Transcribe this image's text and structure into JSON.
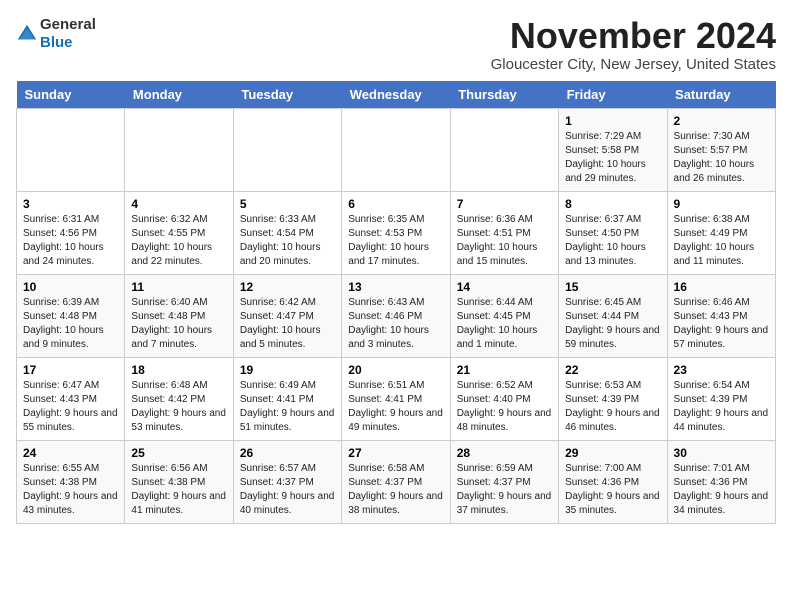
{
  "logo": {
    "general": "General",
    "blue": "Blue"
  },
  "header": {
    "month": "November 2024",
    "location": "Gloucester City, New Jersey, United States"
  },
  "days_of_week": [
    "Sunday",
    "Monday",
    "Tuesday",
    "Wednesday",
    "Thursday",
    "Friday",
    "Saturday"
  ],
  "weeks": [
    [
      {
        "day": "",
        "info": ""
      },
      {
        "day": "",
        "info": ""
      },
      {
        "day": "",
        "info": ""
      },
      {
        "day": "",
        "info": ""
      },
      {
        "day": "",
        "info": ""
      },
      {
        "day": "1",
        "info": "Sunrise: 7:29 AM\nSunset: 5:58 PM\nDaylight: 10 hours and 29 minutes."
      },
      {
        "day": "2",
        "info": "Sunrise: 7:30 AM\nSunset: 5:57 PM\nDaylight: 10 hours and 26 minutes."
      }
    ],
    [
      {
        "day": "3",
        "info": "Sunrise: 6:31 AM\nSunset: 4:56 PM\nDaylight: 10 hours and 24 minutes."
      },
      {
        "day": "4",
        "info": "Sunrise: 6:32 AM\nSunset: 4:55 PM\nDaylight: 10 hours and 22 minutes."
      },
      {
        "day": "5",
        "info": "Sunrise: 6:33 AM\nSunset: 4:54 PM\nDaylight: 10 hours and 20 minutes."
      },
      {
        "day": "6",
        "info": "Sunrise: 6:35 AM\nSunset: 4:53 PM\nDaylight: 10 hours and 17 minutes."
      },
      {
        "day": "7",
        "info": "Sunrise: 6:36 AM\nSunset: 4:51 PM\nDaylight: 10 hours and 15 minutes."
      },
      {
        "day": "8",
        "info": "Sunrise: 6:37 AM\nSunset: 4:50 PM\nDaylight: 10 hours and 13 minutes."
      },
      {
        "day": "9",
        "info": "Sunrise: 6:38 AM\nSunset: 4:49 PM\nDaylight: 10 hours and 11 minutes."
      }
    ],
    [
      {
        "day": "10",
        "info": "Sunrise: 6:39 AM\nSunset: 4:48 PM\nDaylight: 10 hours and 9 minutes."
      },
      {
        "day": "11",
        "info": "Sunrise: 6:40 AM\nSunset: 4:48 PM\nDaylight: 10 hours and 7 minutes."
      },
      {
        "day": "12",
        "info": "Sunrise: 6:42 AM\nSunset: 4:47 PM\nDaylight: 10 hours and 5 minutes."
      },
      {
        "day": "13",
        "info": "Sunrise: 6:43 AM\nSunset: 4:46 PM\nDaylight: 10 hours and 3 minutes."
      },
      {
        "day": "14",
        "info": "Sunrise: 6:44 AM\nSunset: 4:45 PM\nDaylight: 10 hours and 1 minute."
      },
      {
        "day": "15",
        "info": "Sunrise: 6:45 AM\nSunset: 4:44 PM\nDaylight: 9 hours and 59 minutes."
      },
      {
        "day": "16",
        "info": "Sunrise: 6:46 AM\nSunset: 4:43 PM\nDaylight: 9 hours and 57 minutes."
      }
    ],
    [
      {
        "day": "17",
        "info": "Sunrise: 6:47 AM\nSunset: 4:43 PM\nDaylight: 9 hours and 55 minutes."
      },
      {
        "day": "18",
        "info": "Sunrise: 6:48 AM\nSunset: 4:42 PM\nDaylight: 9 hours and 53 minutes."
      },
      {
        "day": "19",
        "info": "Sunrise: 6:49 AM\nSunset: 4:41 PM\nDaylight: 9 hours and 51 minutes."
      },
      {
        "day": "20",
        "info": "Sunrise: 6:51 AM\nSunset: 4:41 PM\nDaylight: 9 hours and 49 minutes."
      },
      {
        "day": "21",
        "info": "Sunrise: 6:52 AM\nSunset: 4:40 PM\nDaylight: 9 hours and 48 minutes."
      },
      {
        "day": "22",
        "info": "Sunrise: 6:53 AM\nSunset: 4:39 PM\nDaylight: 9 hours and 46 minutes."
      },
      {
        "day": "23",
        "info": "Sunrise: 6:54 AM\nSunset: 4:39 PM\nDaylight: 9 hours and 44 minutes."
      }
    ],
    [
      {
        "day": "24",
        "info": "Sunrise: 6:55 AM\nSunset: 4:38 PM\nDaylight: 9 hours and 43 minutes."
      },
      {
        "day": "25",
        "info": "Sunrise: 6:56 AM\nSunset: 4:38 PM\nDaylight: 9 hours and 41 minutes."
      },
      {
        "day": "26",
        "info": "Sunrise: 6:57 AM\nSunset: 4:37 PM\nDaylight: 9 hours and 40 minutes."
      },
      {
        "day": "27",
        "info": "Sunrise: 6:58 AM\nSunset: 4:37 PM\nDaylight: 9 hours and 38 minutes."
      },
      {
        "day": "28",
        "info": "Sunrise: 6:59 AM\nSunset: 4:37 PM\nDaylight: 9 hours and 37 minutes."
      },
      {
        "day": "29",
        "info": "Sunrise: 7:00 AM\nSunset: 4:36 PM\nDaylight: 9 hours and 35 minutes."
      },
      {
        "day": "30",
        "info": "Sunrise: 7:01 AM\nSunset: 4:36 PM\nDaylight: 9 hours and 34 minutes."
      }
    ]
  ]
}
